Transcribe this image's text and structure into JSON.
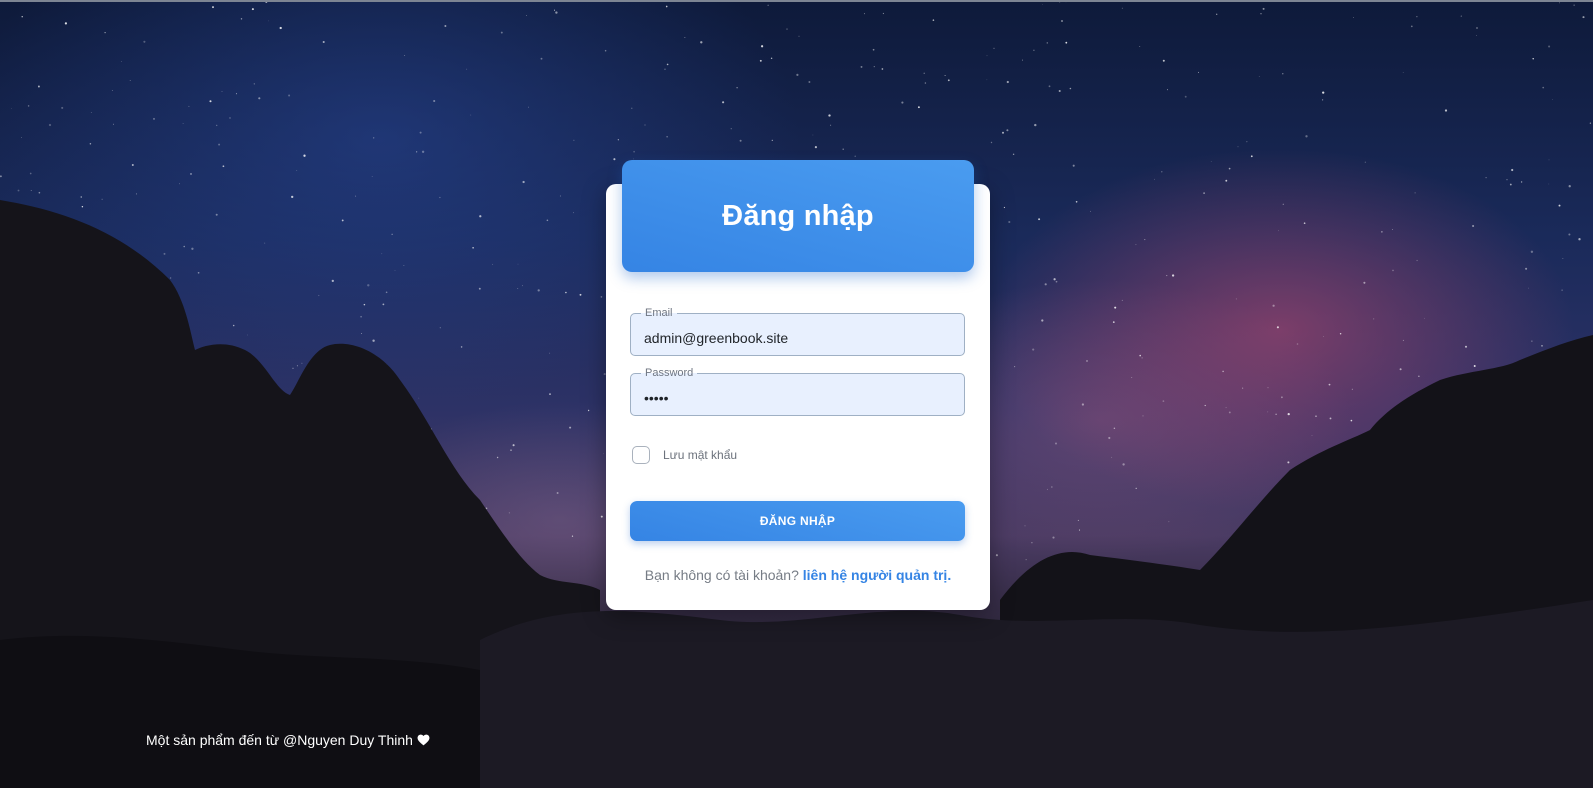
{
  "page": {
    "title": "Đăng nhập"
  },
  "form": {
    "email": {
      "label": "Email",
      "value": "admin@greenbook.site"
    },
    "password": {
      "label": "Password",
      "value": "•••••"
    },
    "remember_label": "Lưu mật khẩu",
    "remember_checked": false,
    "submit_label": "ĐĂNG NHẬP",
    "signup_prompt": "Bạn không có tài khoản?",
    "signup_link": "liên hệ người quản trị."
  },
  "footer": {
    "text": "Một sản phẩm đến từ @Nguyen Duy Thinh",
    "icon": "heart-icon"
  },
  "colors": {
    "accent": "#3584e4",
    "field_background": "#e8f0fe",
    "card_background": "#ffffff"
  }
}
